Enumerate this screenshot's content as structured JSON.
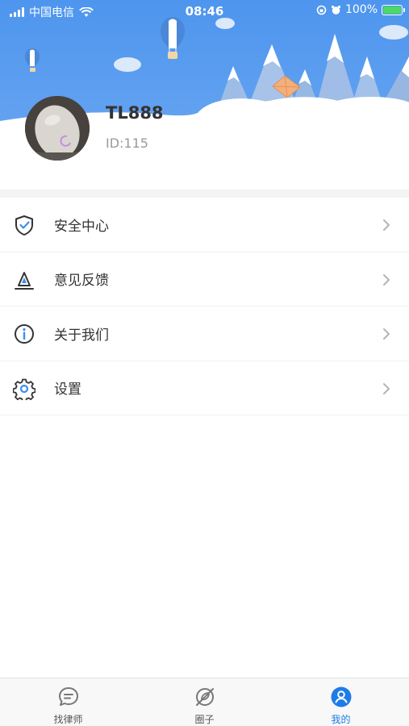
{
  "status_bar": {
    "carrier": "中国电信",
    "time": "08:46",
    "battery_percent": "100%"
  },
  "profile": {
    "username": "TL888",
    "user_id": "ID:115"
  },
  "menu": {
    "items": [
      {
        "label": "安全中心",
        "icon": "shield-check-icon"
      },
      {
        "label": "意见反馈",
        "icon": "feedback-pen-icon"
      },
      {
        "label": "关于我们",
        "icon": "info-icon"
      },
      {
        "label": "设置",
        "icon": "gear-icon"
      }
    ]
  },
  "tabbar": {
    "tabs": [
      {
        "label": "找律师",
        "icon": "chat-bubble-icon",
        "active": false
      },
      {
        "label": "圈子",
        "icon": "leaf-planet-icon",
        "active": false
      },
      {
        "label": "我的",
        "icon": "user-circle-icon",
        "active": true
      }
    ]
  },
  "colors": {
    "sky": "#5b9ef0",
    "accent": "#1e7ce8",
    "mountain": "#9cbde8"
  }
}
